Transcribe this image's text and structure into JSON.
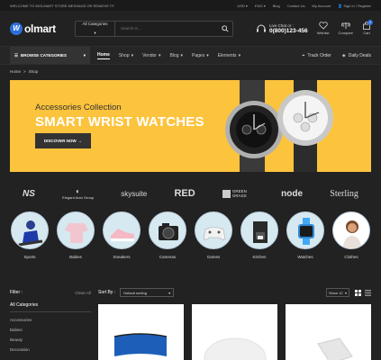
{
  "topbar": {
    "welcome": "WELCOME TO WOLMART STORE MESSAGE OR REMOVE IT!",
    "currency": "USD",
    "language": "ENG",
    "blog": "Blog",
    "contact_us": "Contact Us",
    "my_account": "My Account",
    "signin": "Sign In / Register"
  },
  "logo": {
    "mark": "W",
    "text": "olmart"
  },
  "search": {
    "category": "All Categories",
    "placeholder": "Search in..."
  },
  "contact": {
    "label": "Live Chat or :",
    "phone": "0(800)123-456"
  },
  "header_icons": {
    "wishlist": "Wishlist",
    "compare": "Compare",
    "cart": "Cart",
    "cart_count": "0"
  },
  "nav": {
    "browse": "BROWSE CATEGORIES",
    "items": [
      "Home",
      "Shop",
      "Vendor",
      "Blog",
      "Pages",
      "Elements"
    ],
    "track": "Track Order",
    "deals": "Daily Deals"
  },
  "breadcrumb": {
    "home": "Home",
    "sep": ">",
    "current": "Shop"
  },
  "banner": {
    "subtitle": "Accessories Collection",
    "title": "SMART WRIST WATCHES",
    "button": "DISCOVER NOW"
  },
  "brands": [
    "NS",
    "Elegant Auto Group",
    "skysuite",
    "RED",
    "GREEN GRASS",
    "node",
    "Sterling"
  ],
  "categories": [
    "Sports",
    "Babies",
    "Sneakers",
    "Cameras",
    "Games",
    "Kitchen",
    "Watches",
    "Clothes"
  ],
  "filter": {
    "title": "Filter :",
    "clear": "Clean All",
    "all_categories": "All Categories",
    "items": [
      "Accessories",
      "Babies",
      "Beauty",
      "Decoration"
    ]
  },
  "toolbar": {
    "sort_label": "Sort By :",
    "sort_value": "Default sorting",
    "show_value": "Show 12"
  },
  "colors": {
    "accent": "#2c6fdc",
    "banner": "#fcc33d",
    "background": "#222222"
  }
}
